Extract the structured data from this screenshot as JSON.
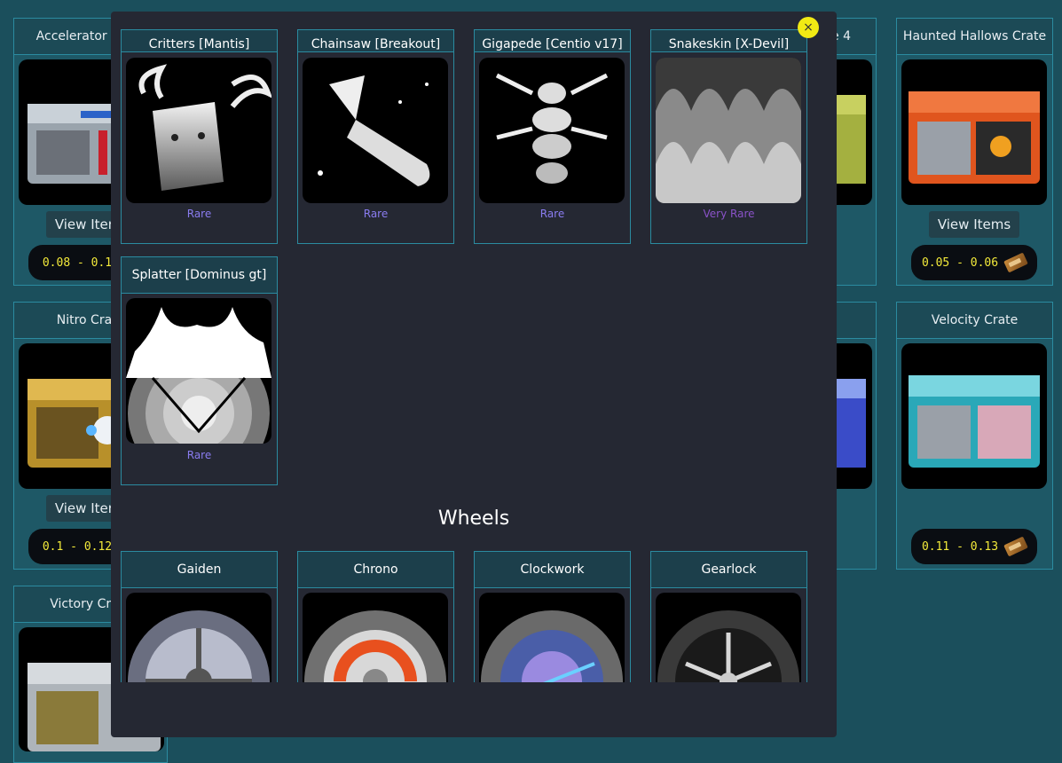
{
  "crates": [
    {
      "id": "accelerator",
      "title": "Accelerator Crate",
      "view": "View Items",
      "price": "0.08 - 0.1"
    },
    {
      "id": "haunted",
      "title": "Haunted Hallows Crate",
      "view": "View Items",
      "price": "0.05 - 0.06"
    },
    {
      "id": "nitro",
      "title": "Nitro Crate",
      "view": "View Items",
      "price": "0.1 - 0.12"
    },
    {
      "id": "velocity",
      "title": "Velocity Crate",
      "view": "",
      "price": "0.11 - 0.13"
    },
    {
      "id": "victory",
      "title": "Victory Crate"
    },
    {
      "id": "crate4",
      "title": "e 4"
    }
  ],
  "modal": {
    "close_label": "×",
    "decals": [
      {
        "name": "Critters [Mantis]",
        "rarity": "Rare"
      },
      {
        "name": "Chainsaw [Breakout]",
        "rarity": "Rare"
      },
      {
        "name": "Gigapede [Centio v17]",
        "rarity": "Rare"
      },
      {
        "name": "Snakeskin [X-Devil]",
        "rarity": "Very Rare"
      },
      {
        "name": "Splatter [Dominus gt]",
        "rarity": "Rare"
      }
    ],
    "wheels_title": "Wheels",
    "wheels": [
      {
        "name": "Gaiden"
      },
      {
        "name": "Chrono"
      },
      {
        "name": "Clockwork"
      },
      {
        "name": "Gearlock"
      }
    ]
  },
  "colors": {
    "rare": "#8a7cf0",
    "very_rare": "#8a52c8",
    "price": "#f3ea3a",
    "accent": "#2b8ba0"
  }
}
